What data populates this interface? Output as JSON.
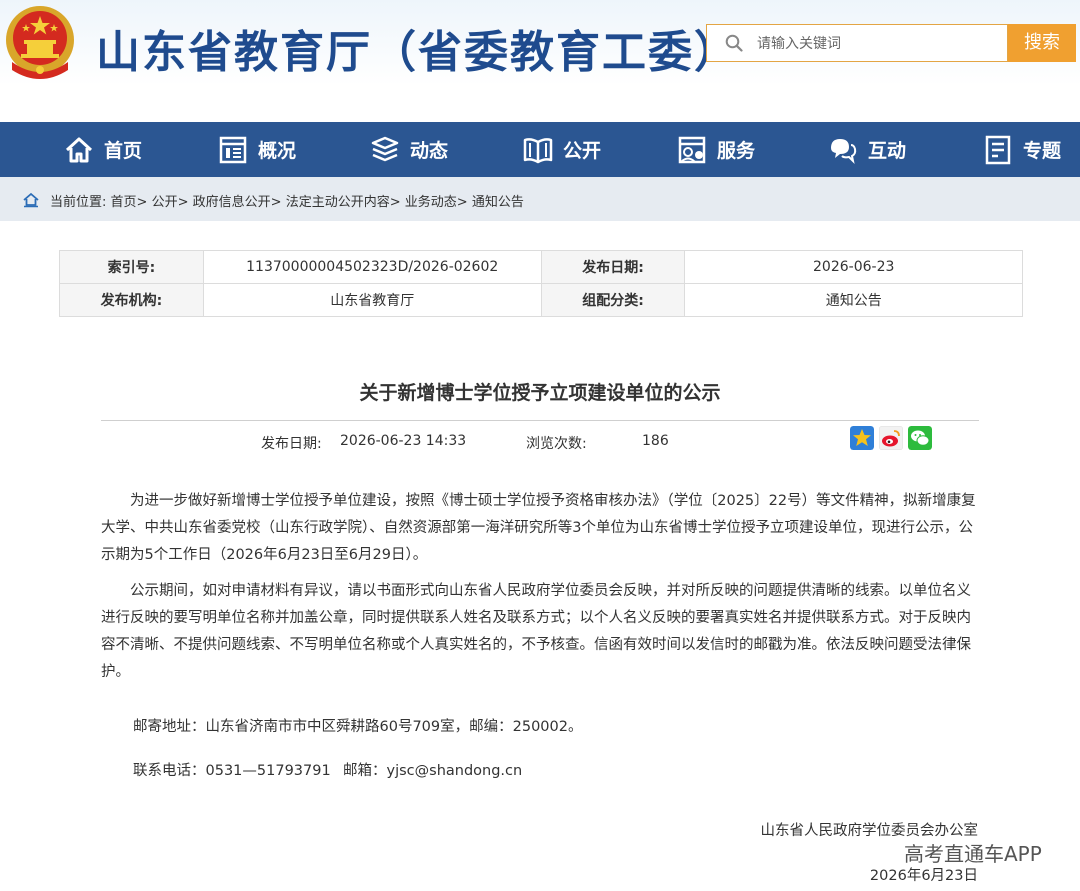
{
  "header": {
    "site_title": "山东省教育厅（省委教育工委）",
    "search": {
      "placeholder": "请输入关键词",
      "button_label": "搜索"
    }
  },
  "nav": {
    "items": [
      {
        "label": "首页",
        "icon": "home-icon"
      },
      {
        "label": "概况",
        "icon": "overview-icon"
      },
      {
        "label": "动态",
        "icon": "news-icon"
      },
      {
        "label": "公开",
        "icon": "book-icon"
      },
      {
        "label": "服务",
        "icon": "service-icon"
      },
      {
        "label": "互动",
        "icon": "chat-icon"
      },
      {
        "label": "专题",
        "icon": "topic-icon"
      }
    ]
  },
  "breadcrumb": {
    "prefix": "当前位置:",
    "items": [
      "首页",
      "公开",
      "政府信息公开",
      "法定主动公开内容",
      "业务动态",
      "通知公告"
    ],
    "separator": ">"
  },
  "info": {
    "index_label": "索引号:",
    "index_value": "11370000004502323D/2026-02602",
    "date_label": "发布日期:",
    "date_value": "2026-06-23",
    "org_label": "发布机构:",
    "org_value": "山东省教育厅",
    "category_label": "组配分类:",
    "category_value": "通知公告"
  },
  "article": {
    "title": "关于新增博士学位授予立项建设单位的公示",
    "meta_date_label": "发布日期:",
    "meta_date_value": "2026-06-23 14:33",
    "meta_views_label": "浏览次数:",
    "meta_views_value": "186",
    "paragraphs": [
      "为进一步做好新增博士学位授予单位建设，按照《博士硕士学位授予资格审核办法》（学位〔2025〕22号）等文件精神，拟新增康复大学、中共山东省委党校（山东行政学院）、自然资源部第一海洋研究所等3个单位为山东省博士学位授予立项建设单位，现进行公示，公示期为5个工作日（2026年6月23日至6月29日）。",
      "公示期间，如对申请材料有异议，请以书面形式向山东省人民政府学位委员会反映，并对所反映的问题提供清晰的线索。以单位名义进行反映的要写明单位名称并加盖公章，同时提供联系人姓名及联系方式；以个人名义反映的要署真实姓名并提供联系方式。对于反映内容不清晰、不提供问题线索、不写明单位名称或个人真实姓名的，不予核查。信函有效时间以发信时的邮戳为准。依法反映问题受法律保护。"
    ],
    "address": "邮寄地址：山东省济南市市中区舜耕路60号709室，邮编：250002。",
    "phone": "联系电话：0531—51793791",
    "email": "邮箱：yjsc@shandong.cn",
    "signature": "山东省人民政府学位委员会办公室",
    "sign_date": "2026年6月23日"
  },
  "watermark": "高考直通车APP",
  "colors": {
    "nav_bg": "#2b5692",
    "title_blue": "#1f4b8e",
    "search_orange": "#f0a030"
  }
}
